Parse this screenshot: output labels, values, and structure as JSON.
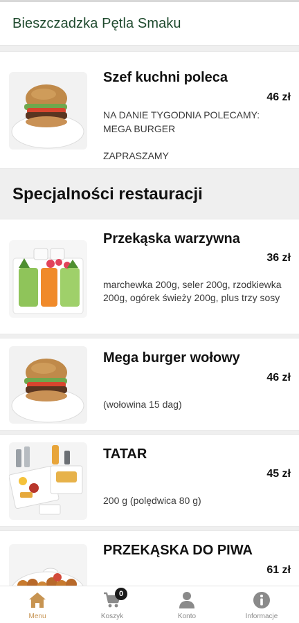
{
  "header": {
    "title": "Bieszczadzka Pętla Smaku"
  },
  "featured": {
    "name": "Szef kuchni poleca",
    "price": "46 zł",
    "desc_line1": "NA DANIE TYGODNIA POLECAMY:",
    "desc_line2": "MEGA BURGER",
    "desc_line3": "ZAPRASZAMY"
  },
  "section": {
    "title": "Specjalności restauracji"
  },
  "items": [
    {
      "name": "Przekąska warzywna",
      "price": "36 zł",
      "desc": "marchewka 200g, seler 200g, rzodkiewka 200g, ogórek świeży 200g, plus trzy sosy"
    },
    {
      "name": "Mega burger wołowy",
      "price": "46 zł",
      "desc": "(wołowina 15 dag)"
    },
    {
      "name": "TATAR",
      "price": "45 zł",
      "desc": "200 g (polędwica 80 g)"
    },
    {
      "name": "PRZEKĄSKA DO PIWA",
      "price": "61 zł",
      "desc": ""
    }
  ],
  "bottom_nav": [
    {
      "label": "Menu",
      "icon": "home-icon",
      "active": true
    },
    {
      "label": "Koszyk",
      "icon": "cart-icon",
      "badge": "0"
    },
    {
      "label": "Konto",
      "icon": "person-icon"
    },
    {
      "label": "Informacje",
      "icon": "info-icon"
    }
  ],
  "colors": {
    "accent": "#c79452",
    "title_green": "#1f4a2e",
    "nav_grey": "#8a8a8a"
  }
}
